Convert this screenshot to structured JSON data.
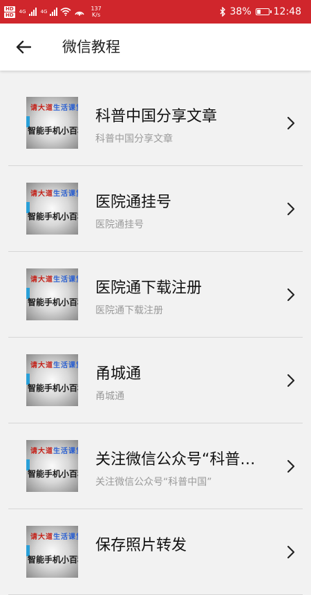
{
  "status_bar": {
    "hd1": "HD",
    "hd2": "HD",
    "net1": "4G",
    "net2": "4G",
    "speed_value": "137",
    "speed_unit": "K/s",
    "battery_percent_text": "38%",
    "battery_level": 0.38,
    "time": "12:48"
  },
  "header": {
    "title": "微信教程"
  },
  "items": [
    {
      "title": "科普中国分享文章",
      "subtitle": "科普中国分享文章"
    },
    {
      "title": "医院通挂号",
      "subtitle": "医院通挂号"
    },
    {
      "title": "医院通下载注册",
      "subtitle": "医院通下载注册"
    },
    {
      "title": "甬城通",
      "subtitle": "甬城通"
    },
    {
      "title": "关注微信公众号“科普中国”",
      "subtitle": "关注微信公众号“科普中国”"
    },
    {
      "title": "保存照片转发",
      "subtitle": ""
    }
  ],
  "thumbnail": {
    "line1_red": "请大道",
    "line1_blue": "生活课堂",
    "line2": "智能手机小百科"
  },
  "colors": {
    "statusbar": "#d0262c",
    "background": "#f2f2f2"
  }
}
